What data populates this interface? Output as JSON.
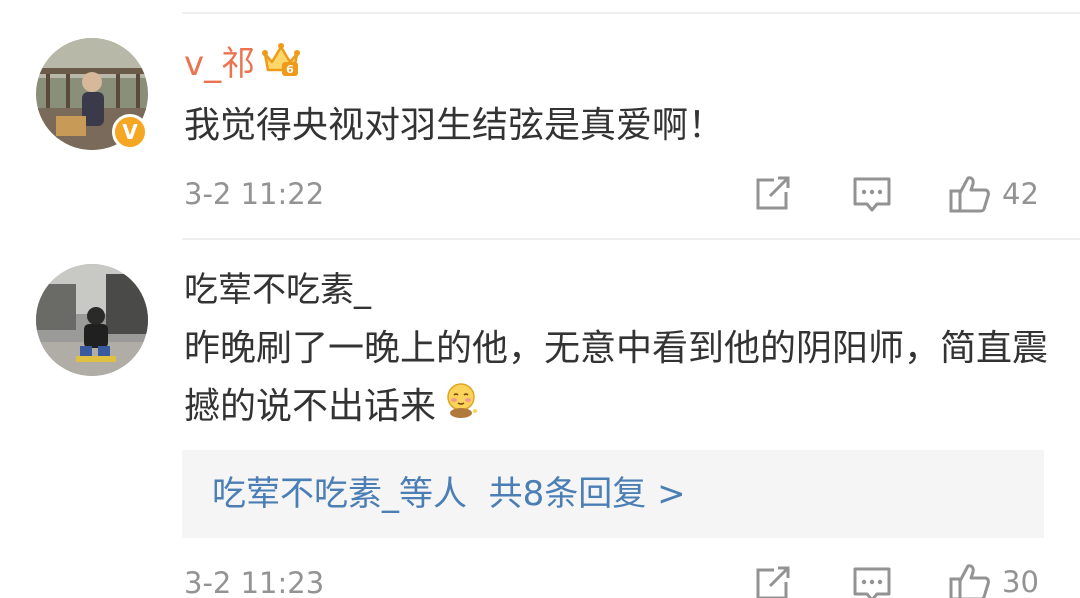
{
  "comments": [
    {
      "username": "v_祁",
      "vip_badge_icon": "vip-crown-icon",
      "verified_icon": "verified-v-icon",
      "verified_label": "V",
      "content": "我觉得央视对羽生结弦是真爱啊！",
      "timestamp": "3-2 11:22",
      "likes": "42"
    },
    {
      "username": "吃荤不吃素_",
      "content": "昨晚刷了一晚上的他，无意中看到他的阴阳师，简直震撼的说不出话来",
      "emoji_icon": "shy-face-emoji-icon",
      "replies": {
        "names": "吃荤不吃素_",
        "suffix": "等人",
        "count_text": "共8条回复",
        "arrow": ">"
      },
      "timestamp": "3-2 11:23",
      "likes": "30"
    }
  ],
  "colors": {
    "vip_username": "#eb7350",
    "username": "#333333",
    "content": "#333333",
    "meta": "#939393",
    "link": "#4a7eb5",
    "verified": "#f5a623",
    "reply_bg": "#f5f5f5"
  }
}
